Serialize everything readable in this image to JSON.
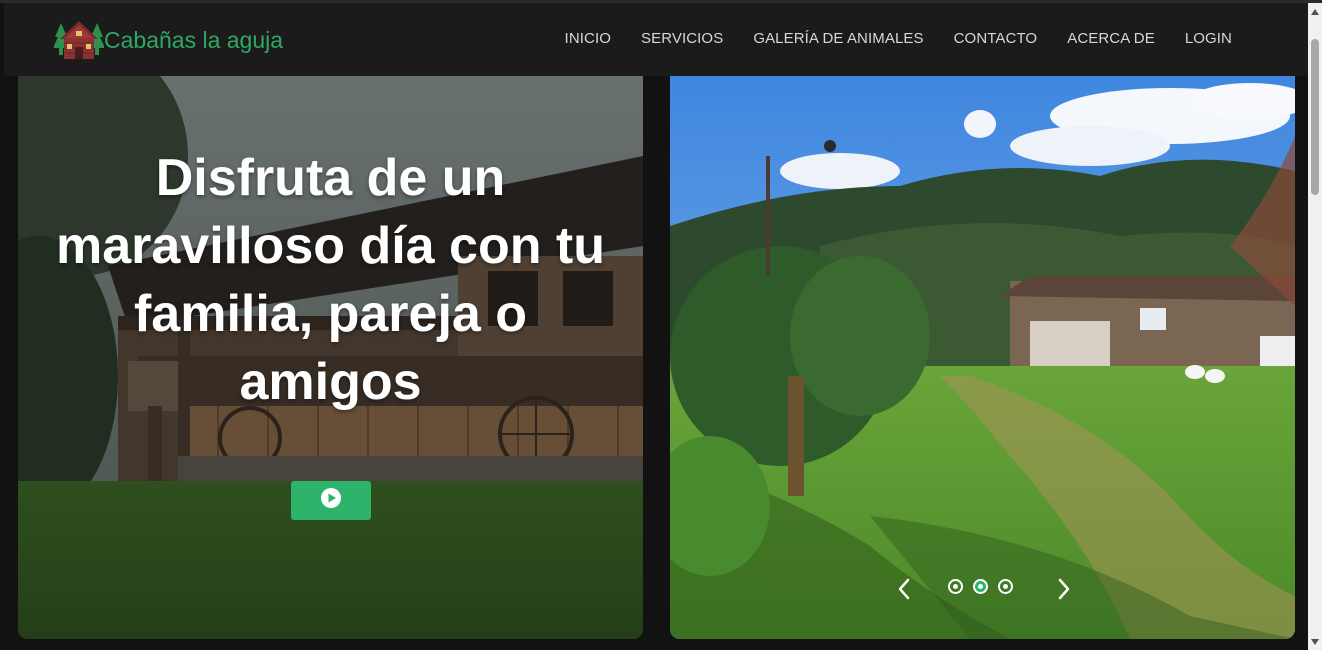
{
  "brand": {
    "name": "Cabañas la aguja",
    "logo_icon": "cabin-trees-icon"
  },
  "nav": {
    "items": [
      {
        "label": "INICIO"
      },
      {
        "label": "SERVICIOS"
      },
      {
        "label": "GALERÍA DE ANIMALES"
      },
      {
        "label": "CONTACTO"
      },
      {
        "label": "ACERCA DE"
      },
      {
        "label": "LOGIN"
      }
    ]
  },
  "hero": {
    "title": "Disfruta de un maravilloso día con tu familia, pareja o amigos",
    "play_icon": "play-icon"
  },
  "carousel": {
    "slide_count": 3,
    "active_index": 1,
    "prev_icon": "chevron-left-icon",
    "next_icon": "chevron-right-icon"
  },
  "colors": {
    "accent": "#2eb36b",
    "navbar_bg": "#1b1b1b",
    "page_bg": "#121212"
  }
}
